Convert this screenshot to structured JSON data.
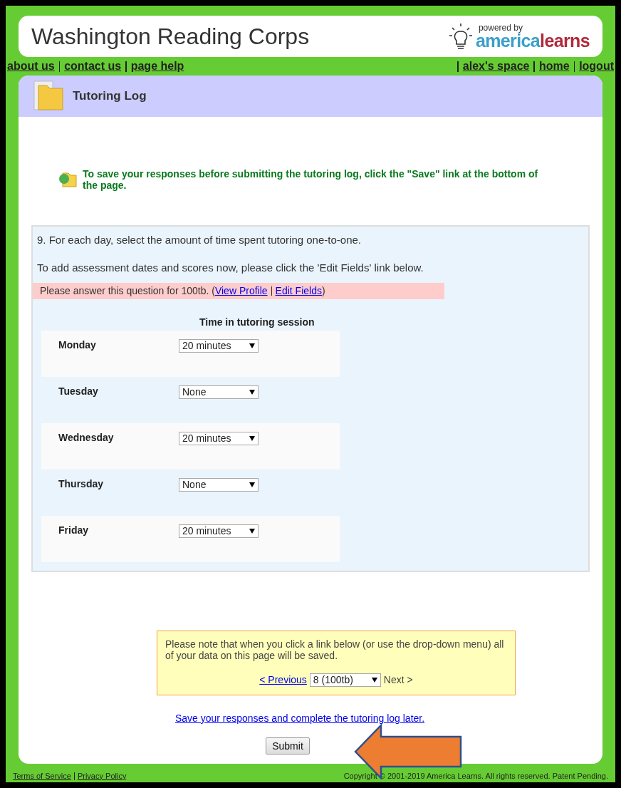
{
  "header": {
    "title": "Washington Reading Corps",
    "powered_by": "powered by",
    "brand_part1": "america",
    "brand_part2": "learns"
  },
  "nav_left": [
    "about us",
    "contact us",
    "page help"
  ],
  "nav_right": [
    "alex's space",
    "home",
    "logout"
  ],
  "page_title": "Tutoring Log",
  "save_notice": "To save your responses before submitting the tutoring log, click the \"Save\" link at the bottom of the page.",
  "question": {
    "text": "9. For each day, select the amount of time spent tutoring one-to-one.",
    "hint": "To add assessment dates and scores now, please click the 'Edit Fields' link below.",
    "alert": "Please answer this question for 100tb. (",
    "alert_links": [
      "View Profile",
      "Edit Fields"
    ],
    "alert_end": ")",
    "column_header": "Time in tutoring session",
    "rows": [
      {
        "day": "Monday",
        "value": "20 minutes"
      },
      {
        "day": "Tuesday",
        "value": "None"
      },
      {
        "day": "Wednesday",
        "value": "20 minutes"
      },
      {
        "day": "Thursday",
        "value": "None"
      },
      {
        "day": "Friday",
        "value": "20 minutes"
      }
    ]
  },
  "note": {
    "text": "Please note that when you click a link below (or use the drop-down menu) all of your data on this page will be saved.",
    "previous": "< Previous",
    "select_value": "8 (100tb)",
    "next": "Next >"
  },
  "save_later": "Save your responses and complete the tutoring log later.",
  "submit": "Submit",
  "footer": {
    "links": [
      "Terms of Service",
      "Privacy Policy"
    ],
    "copyright": "Copyright © 2001-2019 America Learns. All rights reserved. Patent Pending."
  }
}
